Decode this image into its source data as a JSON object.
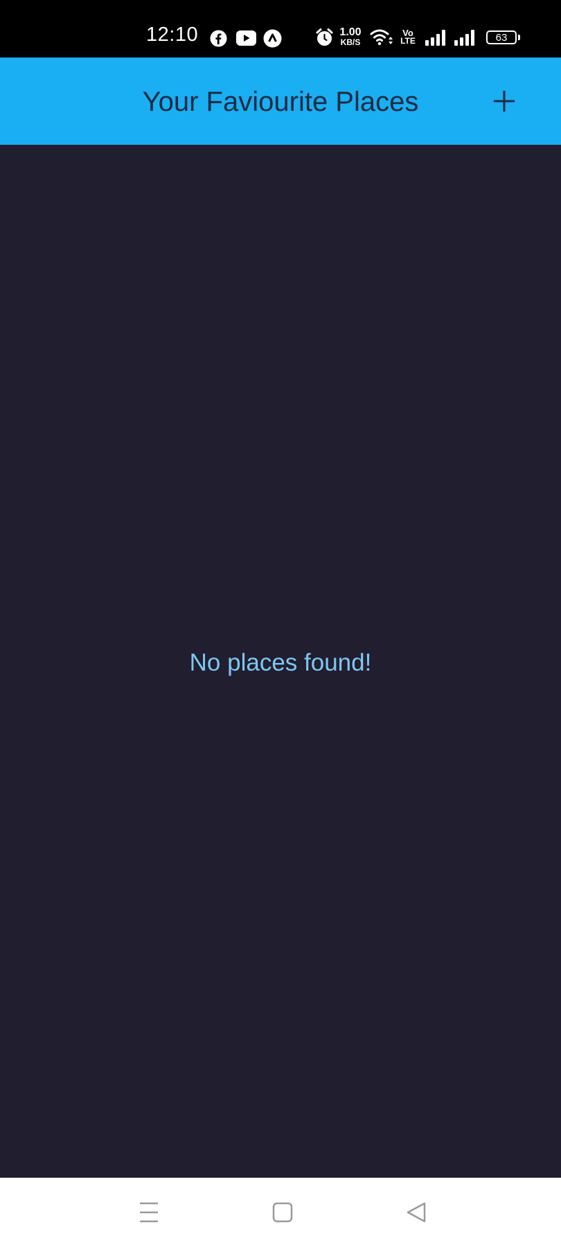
{
  "status_bar": {
    "time": "12:10",
    "notification_icons": [
      "facebook-icon",
      "youtube-icon",
      "app-notification-icon"
    ],
    "alarm_icon": "alarm-icon",
    "network_speed_value": "1.00",
    "network_speed_unit": "KB/S",
    "wifi_icon": "wifi-icon",
    "volte_label_top": "Vo",
    "volte_label_bottom": "LTE",
    "signal_icons": [
      "signal-sim1-icon",
      "signal-sim2-icon"
    ],
    "battery_level": "63"
  },
  "app_bar": {
    "title": "Your Faviourite Places",
    "add_icon": "plus-icon",
    "background_color": "#1aaef2",
    "title_color": "#1c2b44"
  },
  "main": {
    "empty_message": "No places found!",
    "background_color": "#211e2f",
    "message_color": "#7fc6f2"
  },
  "nav_bar": {
    "buttons": [
      "recent-apps-icon",
      "home-icon",
      "back-icon"
    ]
  }
}
